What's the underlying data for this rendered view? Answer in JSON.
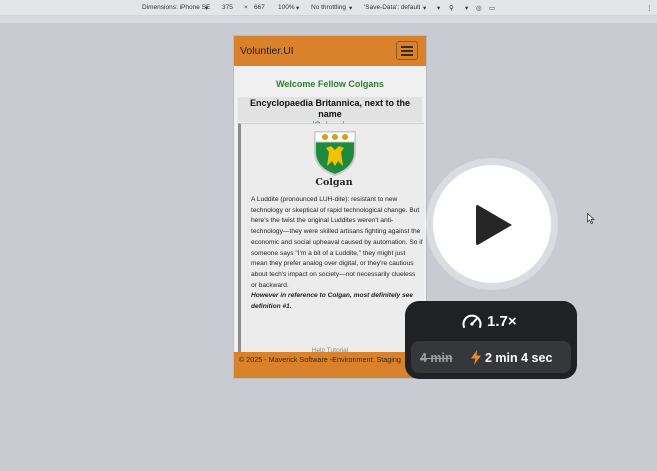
{
  "devtools": {
    "dimensions_label": "Dimensions: iPhone SE",
    "width": "375",
    "times": "×",
    "height": "667",
    "zoom": "100%",
    "throttle": "No throttling",
    "save_data": "'Save-Data': default"
  },
  "app": {
    "brand": "Voluntier.UI",
    "welcome": "Welcome Fellow Colgans",
    "heading_prefix": "Encyclopaedia Britannica, next to the name ",
    "heading_name": "'Colgan'",
    "heading_suffix": ":",
    "crest_name": "Colgan",
    "definition": "A Luddite (pronounced LUH-dite): resistant to new technology or skeptical of rapid technological change. But here's the twist the original Luddites weren't anti-technology—they were skilled artisans fighting against the economic and social upheaval caused by automation. So if someone says \"I'm a bit of a Luddite,\" they might just mean they prefer analog over digital, or they're cautious about tech's impact on society—not necessarily clueless or backward.",
    "emphasis": "However in reference to Colgan, most definitely see definition #1.",
    "cut_text": "Help Tutorial",
    "footer": "© 2025 - Maverick Software -Environment: Staging"
  },
  "overlay": {
    "speed": "1.7×",
    "old_time": "4 min",
    "new_time": "2 min 4 sec"
  },
  "colors": {
    "navbar": "#d9822b",
    "welcome_green": "#2e7d32",
    "speed_card": "#1f2124",
    "bolt": "#f08a24"
  }
}
